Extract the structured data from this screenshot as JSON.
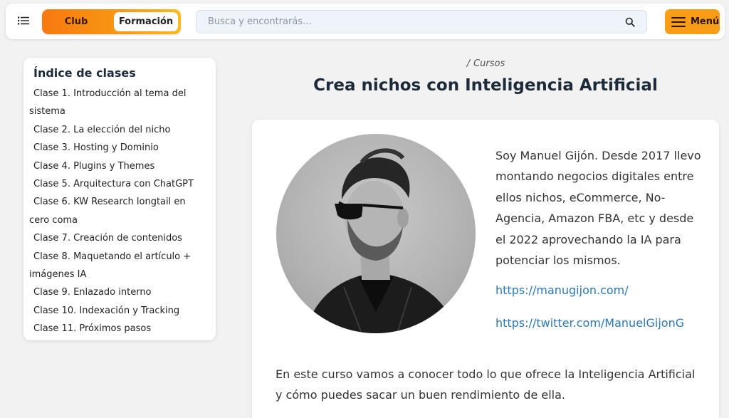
{
  "header": {
    "toggle": {
      "club_label": "Club",
      "formacion_label": "Formación",
      "selected": "Formación"
    },
    "search": {
      "placeholder": "Busca y encontrarás..."
    },
    "menu_label": "Menú",
    "accent_color": "#f99d16"
  },
  "sidebar": {
    "title": "Índice de clases",
    "items": [
      {
        "label": "Clase 1. Introducción al tema del sistema"
      },
      {
        "label": "Clase 2. La elección del nicho"
      },
      {
        "label": "Clase 3. Hosting y Dominio"
      },
      {
        "label": "Clase 4. Plugins y Themes"
      },
      {
        "label": "Clase 5. Arquitectura con ChatGPT"
      },
      {
        "label": "Clase 6. KW Research longtail en cero coma"
      },
      {
        "label": "Clase 7. Creación de contenidos"
      },
      {
        "label": "Clase 8. Maquetando el artículo + imágenes IA"
      },
      {
        "label": "Clase 9. Enlazado interno"
      },
      {
        "label": "Clase 10. Indexación y Tracking"
      },
      {
        "label": "Clase 11. Próximos pasos"
      }
    ]
  },
  "main": {
    "breadcrumb": {
      "separator": "/",
      "current": "Cursos"
    },
    "title": "Crea nichos con Inteligencia Artificial",
    "bio": "Soy Manuel Gijón. Desde 2017 llevo montando negocios digitales entre ellos nichos, eCommerce, No-Agencia, Amazon FBA, etc y desde el 2022 aprovechando la IA para potenciar los mismos.",
    "links": [
      {
        "label": "https://manugijon.com/"
      },
      {
        "label": "https://twitter.com/ManuelGijonG"
      }
    ],
    "intro": "En este curso vamos a conocer todo lo que ofrece la Inteligencia Artificial y cómo puedes sacar un buen rendimiento de ella.",
    "link_color": "#2b78b5"
  },
  "icons": {
    "list": "list-icon",
    "search": "search-icon",
    "menu": "hamburger-icon",
    "portrait": "author-portrait"
  }
}
